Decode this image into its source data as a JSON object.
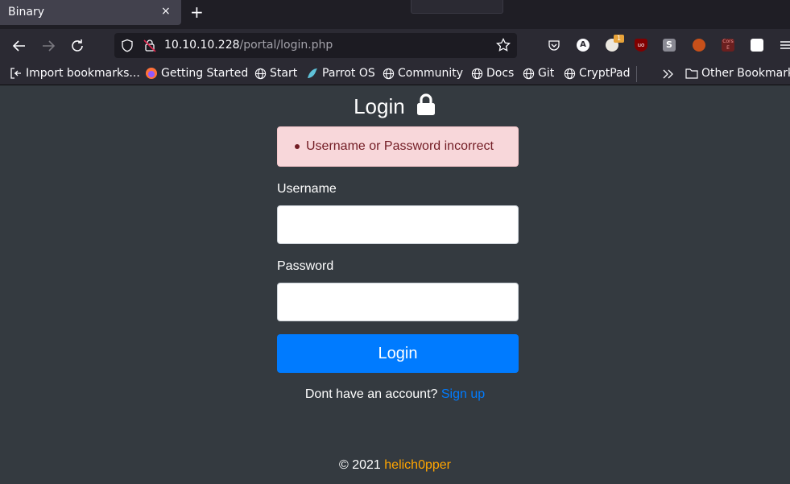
{
  "browser": {
    "tab_title": "Binary",
    "tab_close": "×",
    "new_tab": "+",
    "url_host": "10.10.10.228",
    "url_path": "/portal/login.php",
    "badge_count": "1",
    "bookmarks": [
      {
        "label": "Import bookmarks...",
        "icon": "import-icon"
      },
      {
        "label": "Getting Started",
        "icon": "firefox-icon"
      },
      {
        "label": "Start",
        "icon": "globe-icon"
      },
      {
        "label": "Parrot OS",
        "icon": "parrot-icon"
      },
      {
        "label": "Community",
        "icon": "globe-icon"
      },
      {
        "label": "Docs",
        "icon": "globe-icon"
      },
      {
        "label": "Git",
        "icon": "globe-icon"
      },
      {
        "label": "CryptPad",
        "icon": "globe-icon"
      }
    ],
    "other_bookmarks": "Other Bookmarks"
  },
  "login": {
    "title": "Login",
    "error": "Username or Password incorrect",
    "username_label": "Username",
    "password_label": "Password",
    "username_value": "",
    "password_value": "",
    "submit_label": "Login",
    "signup_prompt": "Dont have an account?",
    "signup_link": "Sign up"
  },
  "footer": {
    "copyright": "© 2021",
    "author": "helich0pper"
  },
  "colors": {
    "page_bg": "#343a40",
    "primary": "#007bff",
    "alert_bg": "#f8d7da",
    "alert_text": "#721c24",
    "author": "#ffa500"
  }
}
